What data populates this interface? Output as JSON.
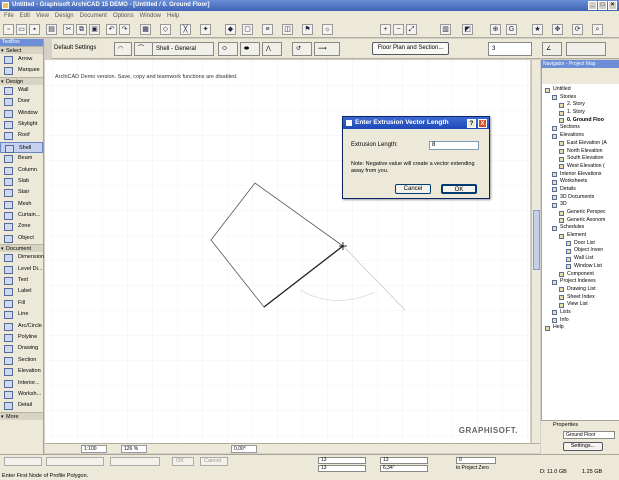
{
  "window": {
    "title": "Untitled - Graphisoft ArchiCAD 15 DEMO - [Untitled / 0. Ground Floor]"
  },
  "menu": [
    "File",
    "Edit",
    "View",
    "Design",
    "Document",
    "Options",
    "Window",
    "Help"
  ],
  "toolbox": {
    "title": "ToolBox",
    "select_label": "Select",
    "top_items": [
      "Arrow",
      "Marquee"
    ],
    "design_label": "Design",
    "design_items": [
      "Wall",
      "Door",
      "Window",
      "Skylight",
      "Roof",
      "Shell",
      "Beam",
      "Column",
      "Slab",
      "Stair",
      "Mesh",
      "Curtain...",
      "Zone",
      "Object"
    ],
    "active_item": "Shell",
    "document_label": "Document",
    "document_items": [
      "Dimension",
      "Level Di...",
      "Text",
      "Label",
      "Fill",
      "Line",
      "Arc/Circle",
      "Polyline",
      "Drawing",
      "Section",
      "Elevation",
      "Interior...",
      "Worksh...",
      "Detail"
    ],
    "more_label": "More"
  },
  "infobox": {
    "settings_label": "Default Settings",
    "layer": "Shell - General",
    "floor_plan_button": "Floor Plan and Section...",
    "height_value": "3"
  },
  "canvas": {
    "notice": "ArchiCAD Demo version. Save, copy and teamwork functions are disabled.",
    "brand": "GRAPHISOFT."
  },
  "bottom_controls": {
    "scale": "1:100",
    "zoom": "126 %",
    "angle": "0,00°"
  },
  "dialog": {
    "title": "Enter Extrusion Vector Length",
    "help": "?",
    "close": "X",
    "field_label": "Extrusion Length:",
    "field_value": "8",
    "note": "Note: Negative value will create a vector extending away from you.",
    "cancel": "Cancel",
    "ok": "OK"
  },
  "navigator": {
    "title": "Navigator - Project Map",
    "tree": [
      {
        "label": "Untitled",
        "indent": 0,
        "bold": false
      },
      {
        "label": "Stories",
        "indent": 1,
        "bold": false
      },
      {
        "label": "2. Story",
        "indent": 2,
        "bold": false
      },
      {
        "label": "1. Story",
        "indent": 2,
        "bold": false
      },
      {
        "label": "0. Ground Floo",
        "indent": 2,
        "bold": true
      },
      {
        "label": "Sections",
        "indent": 1,
        "bold": false
      },
      {
        "label": "Elevations",
        "indent": 1,
        "bold": false
      },
      {
        "label": "East Elevation (A",
        "indent": 2,
        "bold": false
      },
      {
        "label": "North Elevation",
        "indent": 2,
        "bold": false
      },
      {
        "label": "South Elevation",
        "indent": 2,
        "bold": false
      },
      {
        "label": "West Elevation (",
        "indent": 2,
        "bold": false
      },
      {
        "label": "Interior Elevations",
        "indent": 1,
        "bold": false
      },
      {
        "label": "Worksheets",
        "indent": 1,
        "bold": false
      },
      {
        "label": "Details",
        "indent": 1,
        "bold": false
      },
      {
        "label": "3D Documents",
        "indent": 1,
        "bold": false
      },
      {
        "label": "3D",
        "indent": 1,
        "bold": false
      },
      {
        "label": "Generic Perspec",
        "indent": 2,
        "bold": false
      },
      {
        "label": "Generic Axonom",
        "indent": 2,
        "bold": false
      },
      {
        "label": "Schedules",
        "indent": 1,
        "bold": false
      },
      {
        "label": "Element",
        "indent": 2,
        "bold": false
      },
      {
        "label": "Door List",
        "indent": 3,
        "bold": false
      },
      {
        "label": "Object Inven",
        "indent": 3,
        "bold": false
      },
      {
        "label": "Wall List",
        "indent": 3,
        "bold": false
      },
      {
        "label": "Window List",
        "indent": 3,
        "bold": false
      },
      {
        "label": "Component",
        "indent": 2,
        "bold": false
      },
      {
        "label": "Project Indexes",
        "indent": 1,
        "bold": false
      },
      {
        "label": "Drawing List",
        "indent": 2,
        "bold": false
      },
      {
        "label": "Sheet Index",
        "indent": 2,
        "bold": false
      },
      {
        "label": "View List",
        "indent": 2,
        "bold": false
      },
      {
        "label": "Lists",
        "indent": 1,
        "bold": false
      },
      {
        "label": "Info",
        "indent": 1,
        "bold": false
      },
      {
        "label": "Help",
        "indent": 0,
        "bold": false
      }
    ],
    "properties_label": "Properties",
    "properties_story": "Ground Floor",
    "settings_button": "Settings..."
  },
  "statusbar": {
    "hint": "Enter First Node of Profile Polygon.",
    "ok": "OK",
    "cancel": "Cancel",
    "coord_a1": "13",
    "coord_b1": "13",
    "coord_a2": "13",
    "coord_b2": "6,34\"",
    "coord_c1": "0",
    "project_zero": "to Project Zero",
    "disk_space": "D: 11.0 GB",
    "memory": "1.25 GB"
  }
}
